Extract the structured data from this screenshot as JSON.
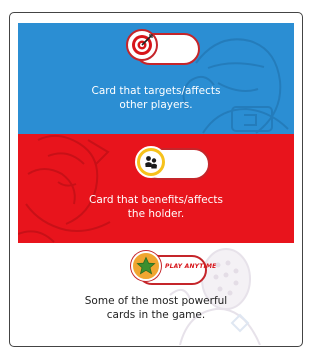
{
  "targets": {
    "line1": "Card that targets/affects",
    "line2": "other players.",
    "icon": "target-icon"
  },
  "benefits": {
    "line1": "Card that benefits/affects",
    "line2": "the holder.",
    "icon": "player-icon"
  },
  "anytime": {
    "label": "PLAY ANYTIME",
    "line1": "Some of the most powerful",
    "line2": "cards in the game.",
    "icon": "star-icon"
  },
  "colors": {
    "blue_band": "#2b8ed3",
    "red_band": "#e8141c",
    "pill_border": "#c5252a",
    "star_circle": "#f0a630",
    "star": "#3c8f2f"
  }
}
